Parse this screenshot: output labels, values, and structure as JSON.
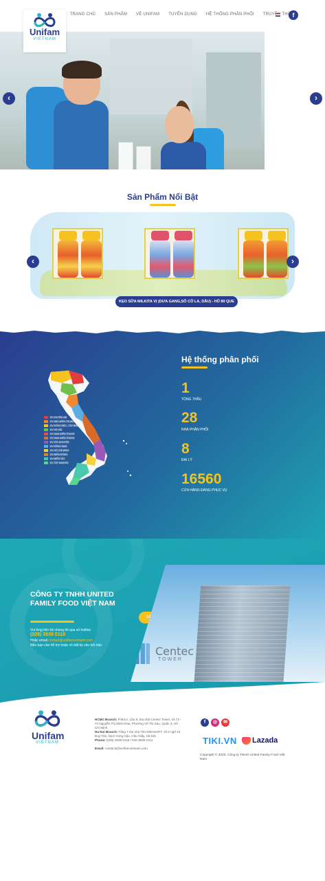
{
  "brand": {
    "name": "Unifam",
    "sub": "VIETNAM"
  },
  "nav": {
    "items": [
      "TRANG CHỦ",
      "SẢN PHẨM",
      "VỀ UNIFAM",
      "TUYỂN DỤNG",
      "HỆ THỐNG PHÂN PHỐI",
      "TRUYỀN THÔNG"
    ]
  },
  "hero": {
    "prev": "‹",
    "next": "›"
  },
  "featured": {
    "title": "Sản Phẩm Nổi Bật",
    "product_button": "KẸO SỮA MILKITA VỊ (DƯA GANG,SÔ CÔ LA, DÂU) - HŨ 80 QUE",
    "prev": "‹",
    "next": "›"
  },
  "distribution": {
    "title": "Hệ thống phân phối",
    "stats": [
      {
        "value": "1",
        "label": "TỔNG THẦU"
      },
      {
        "value": "28",
        "label": "NHÀ PHÂN PHỐI"
      },
      {
        "value": "8",
        "label": "ĐẠI LÝ"
      },
      {
        "value": "16560",
        "label": "CỬA HÀNG ĐANG PHỤC VỤ"
      }
    ],
    "legend": [
      {
        "text": "KV DUYÊN HẢI",
        "color": "#e23c3c"
      },
      {
        "text": "KV BẮC MIỀN TRUNG TÂM",
        "color": "#f08a2b"
      },
      {
        "text": "KV ĐÔNG BẮC - TÂY BẮC BỘ",
        "color": "#f6c21f"
      },
      {
        "text": "KV HÀ NỘI",
        "color": "#6fbf4a"
      },
      {
        "text": "KV NAM MIỀN TRUNG",
        "color": "#d9534f"
      },
      {
        "text": "KV NAM MIỀN TRUNG",
        "color": "#c97a3a"
      },
      {
        "text": "KV TÂY NGUYÊN",
        "color": "#9b59b6"
      },
      {
        "text": "KV ĐÔNG NAM",
        "color": "#5dade2"
      },
      {
        "text": "KV HỒ CHÍ MINH",
        "color": "#f4d03f"
      },
      {
        "text": "KV MIỀN ĐÔNG",
        "color": "#e67e22"
      },
      {
        "text": "KV MIỀN TÂY",
        "color": "#48c9b0"
      },
      {
        "text": "KV TÂY NAM BỘ",
        "color": "#58d68d"
      }
    ]
  },
  "company": {
    "title": "CÔNG TY TNHH UNITED FAMILY FOOD VIỆT NAM",
    "line1": "Vui lòng liên hệ chúng tôi qua số hotline",
    "hotline": "(028) 3939 0118",
    "line2_prefix": "Hoặc email ",
    "email": "contact@unifamvietnam.com",
    "line3": "Nếu bạn cần hỗ trợ hoặc có bất kỳ câu hỏi nào.",
    "contact_button": "LIÊN HỆ NGAY",
    "building_brand": "Centec",
    "building_sub": "TOWER"
  },
  "footer": {
    "hcmc_label": "HCMC Branch:",
    "hcmc_text": "P.901A, Lầu 9, tòa nhà Centec Tower, số 72 - 74 Nguyễn Thị Minh Khai, Phường Võ Thị Sáu, Quận 3, Hồ Chí Minh",
    "hanoi_label": "Ha Noi Branch:",
    "hanoi_text": "Tầng 7 tòa nhà TECHNOSOFT, số 6 ngõ 15 Duy Tân, Dịch Vọng Hậu, Cầu Giấy, Hà Nội",
    "phone_label": "Phone:",
    "phone_text": "(028) 3939 0118 / 028 3939 0112",
    "email_label": "Email:",
    "email_text": "contacts@unifamvietnam.com",
    "tiki": "TIKI.VN",
    "lazada": "Lazada",
    "copyright": "Copyright © 2020. Công ty TNHH United Family Food Việt Nam"
  }
}
